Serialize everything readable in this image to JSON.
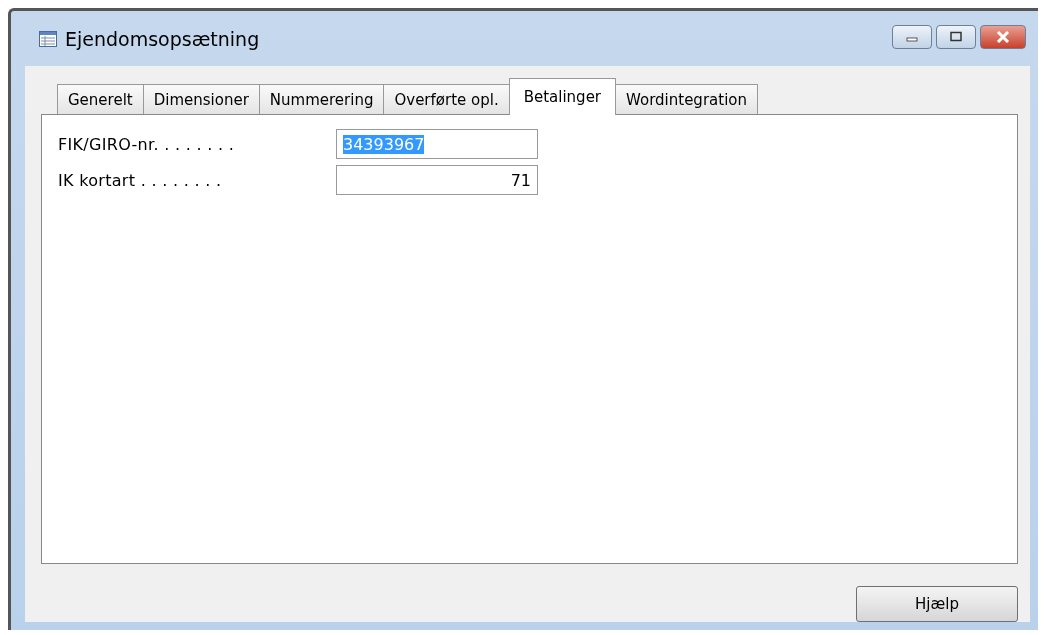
{
  "window": {
    "title": "Ejendomsopsætning"
  },
  "tabs": [
    {
      "label": "Generelt",
      "selected": false
    },
    {
      "label": "Dimensioner",
      "selected": false
    },
    {
      "label": "Nummerering",
      "selected": false
    },
    {
      "label": "Overførte opl.",
      "selected": false
    },
    {
      "label": "Betalinger",
      "selected": true
    },
    {
      "label": "Wordintegration",
      "selected": false
    }
  ],
  "fields": [
    {
      "label": "FIK/GIRO-nr. . . . . . . .",
      "value": "34393967",
      "kind": "text",
      "selected": true
    },
    {
      "label": "IK kortart . . . . . . . .",
      "value": "71",
      "kind": "number",
      "selected": false
    }
  ],
  "buttons": [
    "Hjælp"
  ]
}
